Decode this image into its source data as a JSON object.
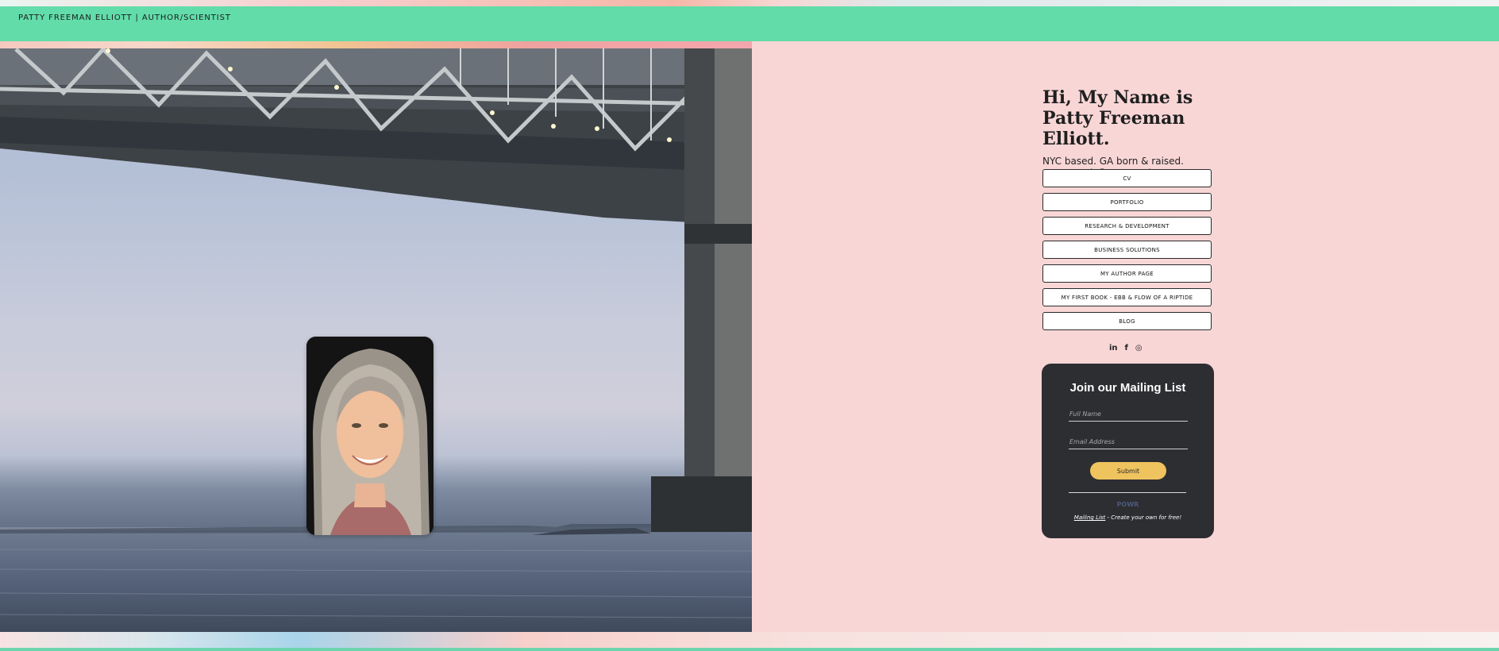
{
  "header": {
    "site_title": "PATTY FREEMAN ELLIOTT | AUTHOR/SCIENTIST"
  },
  "hero": {
    "scene": "bridge-over-water-photo",
    "avatar": "portrait-photo"
  },
  "intro": {
    "greeting_line1": "Hi, My Name is",
    "greeting_line2": "Patty Freeman Elliott.",
    "tagline_line1": "NYC based. GA born & raised.",
    "tagline_line2": "Speak fluent nerd."
  },
  "nav": {
    "items": [
      {
        "label": "CV"
      },
      {
        "label": "PORTFOLIO"
      },
      {
        "label": "RESEARCH & DEVELOPMENT"
      },
      {
        "label": "BUSINESS SOLUTIONS"
      },
      {
        "label": "MY AUTHOR PAGE"
      },
      {
        "label": "MY FIRST BOOK - EBB & FLOW OF A RIPTIDE"
      },
      {
        "label": "BLOG"
      }
    ]
  },
  "social": {
    "linkedin": "in",
    "facebook": "f",
    "instagram": "◎"
  },
  "mailing": {
    "title": "Join our Mailing List",
    "full_name_placeholder": "Full Name",
    "email_placeholder": "Email Address",
    "submit_label": "Submit",
    "powered_by": "POWR",
    "credit_link": "Mailing List",
    "credit_text": " - Create your own for free!"
  },
  "colors": {
    "header_green": "#62dca9",
    "page_pink": "#f9d6d6",
    "card_dark": "#2d2e32",
    "submit_yellow": "#efc35e"
  }
}
